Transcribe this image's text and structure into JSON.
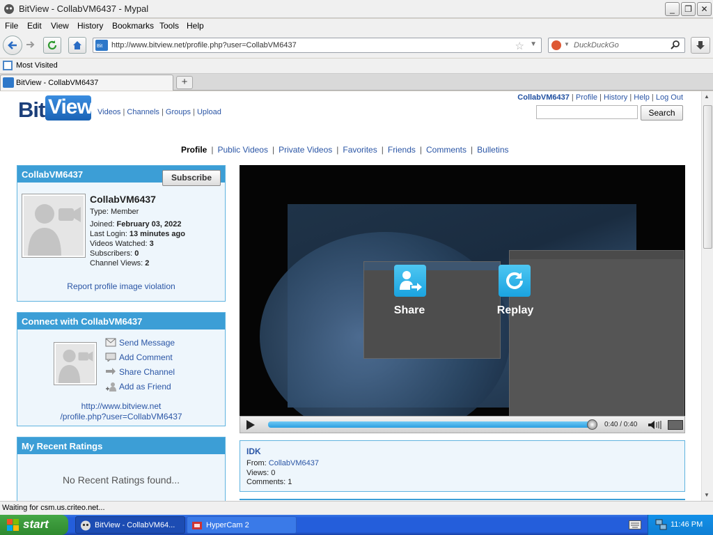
{
  "window": {
    "title": "BitView - CollabVM6437 - Mypal"
  },
  "menu": [
    "File",
    "Edit",
    "View",
    "History",
    "Bookmarks",
    "Tools",
    "Help"
  ],
  "nav": {
    "url": "http://www.bitview.net/profile.php?user=CollabVM6437",
    "search_placeholder": "DuckDuckGo"
  },
  "bookmarks": {
    "most_visited": "Most Visited"
  },
  "tabs": [
    {
      "label": "BitView - CollabVM6437"
    }
  ],
  "site": {
    "logo_bit": "Bit",
    "logo_view": "View",
    "top_links": [
      "Videos",
      "Channels",
      "Groups",
      "Upload"
    ],
    "user_links": {
      "username": "CollabVM6437",
      "items": [
        "Profile",
        "History",
        "Help",
        "Log Out"
      ]
    },
    "search_button": "Search",
    "subnav": [
      "Profile",
      "Public Videos",
      "Private Videos",
      "Favorites",
      "Friends",
      "Comments",
      "Bulletins"
    ]
  },
  "profile": {
    "header": "CollabVM6437",
    "subscribe": "Subscribe",
    "name": "CollabVM6437",
    "type_label": "Type:",
    "type_value": "Member",
    "joined_label": "Joined:",
    "joined_value": "February 03, 2022",
    "login_label": "Last Login:",
    "login_value": "13 minutes ago",
    "watched_label": "Videos Watched:",
    "watched_value": "3",
    "subs_label": "Subscribers:",
    "subs_value": "0",
    "views_label": "Channel Views:",
    "views_value": "2",
    "report": "Report profile image violation"
  },
  "connect": {
    "header": "Connect with CollabVM6437",
    "items": [
      "Send Message",
      "Add Comment",
      "Share Channel",
      "Add as Friend"
    ],
    "url_line1": "http://www.bitview.net",
    "url_line2": "/profile.php?user=CollabVM6437"
  },
  "ratings": {
    "header": "My Recent Ratings",
    "empty": "No Recent Ratings found..."
  },
  "player": {
    "share_label": "Share",
    "replay_label": "Replay",
    "time": "0:40 / 0:40",
    "progress": 1.0
  },
  "video": {
    "title": "IDK",
    "from_label": "From:",
    "from_value": "CollabVM6437",
    "views": "Views: 0",
    "comments": "Comments: 1"
  },
  "status": {
    "text": "Waiting for csm.us.criteo.net..."
  },
  "taskbar": {
    "start": "start",
    "tasks": [
      "BitView - CollabVM64...",
      "HyperCam 2"
    ],
    "clock": "11:46 PM"
  },
  "colors": {
    "link": "#2a55a5",
    "box_header": "#3c9ed6",
    "box_bg": "#eef6fc"
  }
}
